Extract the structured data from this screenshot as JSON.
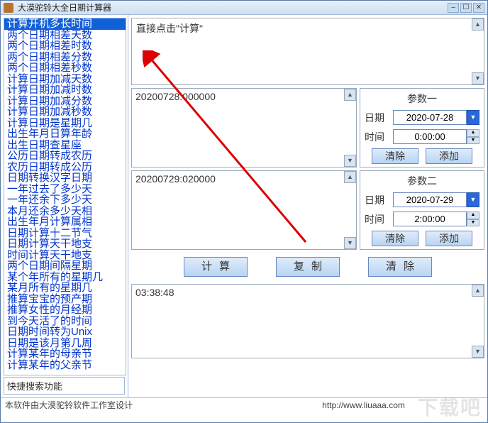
{
  "window": {
    "title": "大漠驼铃大全日期计算器"
  },
  "sidebar": {
    "items": [
      "计算开机多长时间",
      "两个日期相差天数",
      "两个日期相差时数",
      "两个日期相差分数",
      "两个日期相差秒数",
      "计算日期加减天数",
      "计算日期加减时数",
      "计算日期加减分数",
      "计算日期加减秒数",
      "计算日期是星期几",
      "出生年月日算年龄",
      "出生日期查星座",
      "公历日期转成农历",
      "农历日期转成公历",
      "日期转换汉字日期",
      "一年过去了多少天",
      "一年还余下多少天",
      "本月还余多少天相",
      "出生年月计算属相",
      "日期计算十二节气",
      "日期计算天干地支",
      "时间计算天干地支",
      "两个日期间隔星期",
      "某个年所有的星期几",
      "某月所有的星期几",
      "推算宝宝的预产期",
      "推算女性的月经期",
      "到今天活了的时间",
      "日期时间转为Unix",
      "日期是该月第几周",
      "计算某年的母亲节",
      "计算某年的父亲节"
    ],
    "selected_index": 0,
    "search_placeholder": "快捷搜索功能"
  },
  "hint": "直接点击\"计算\"",
  "input1": "20200728:000000",
  "input2": "20200729:020000",
  "param1": {
    "title": "参数一",
    "date_label": "日期",
    "date_value": "2020-07-28",
    "time_label": "时间",
    "time_value": "0:00:00",
    "clear": "清除",
    "add": "添加"
  },
  "param2": {
    "title": "参数二",
    "date_label": "日期",
    "date_value": "2020-07-29",
    "time_label": "时间",
    "time_value": "2:00:00",
    "clear": "清除",
    "add": "添加"
  },
  "buttons": {
    "calc": "计算",
    "copy": "复制",
    "clear": "清除"
  },
  "result": "03:38:48",
  "status": {
    "left": "本软件由大漠驼铃软件工作室设计",
    "url": "http://www.liuaaa.com"
  },
  "watermark": "下载吧"
}
